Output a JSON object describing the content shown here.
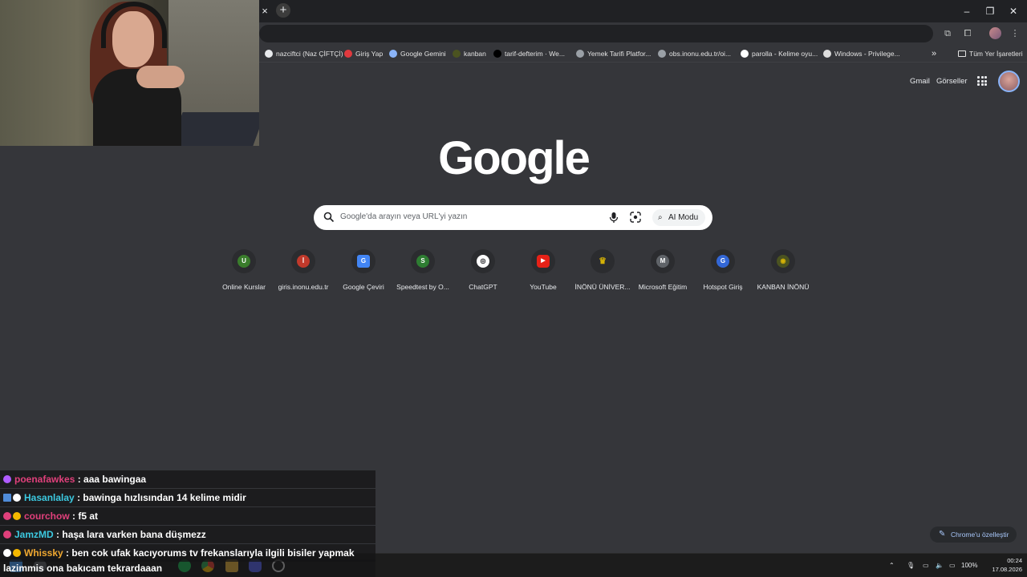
{
  "browser": {
    "tab_close_glyph": "×",
    "new_tab_glyph": "+",
    "window_controls": {
      "minimize": "–",
      "maximize": "❐",
      "close": "✕"
    },
    "toolbar_icons": [
      "cast-icon",
      "extensions-icon",
      "profile-icon",
      "menu-icon"
    ]
  },
  "bookmarks": [
    {
      "label": "nazciftci (Naz ÇİFTÇİ)",
      "icon": "github-icon",
      "color": "#e8eaed"
    },
    {
      "label": "Giriş Yap",
      "icon": "login-icon",
      "color": "#e0393e"
    },
    {
      "label": "Google Gemini",
      "icon": "gemini-icon",
      "color": "#8ab4f8"
    },
    {
      "label": "kanban",
      "icon": "kanban-icon",
      "color": "#4b5320"
    },
    {
      "label": "tarif-defterim · We...",
      "icon": "vercel-icon",
      "color": "#000000"
    },
    {
      "label": "Yemek Tarifi Platfor...",
      "icon": "globe-icon",
      "color": "#9aa0a6"
    },
    {
      "label": "obs.inonu.edu.tr/oi...",
      "icon": "globe-icon",
      "color": "#9aa0a6"
    },
    {
      "label": "parolla - Kelime oyu...",
      "icon": "parolla-icon",
      "color": "#ffffff"
    },
    {
      "label": "Windows - Privilege...",
      "icon": "windows-icon",
      "color": "#dddddd"
    }
  ],
  "bookmarks_more": "»",
  "all_bookmarks": "Tüm Yer İşaretleri",
  "header_links": {
    "gmail": "Gmail",
    "images": "Görseller"
  },
  "logo": "Google",
  "search": {
    "placeholder": "Google'da arayın veya URL'yi yazın",
    "ai_mode_label": "AI Modu"
  },
  "shortcuts": [
    {
      "label": "Online Kurslar",
      "glyph": "U",
      "color": "#3a7d2c"
    },
    {
      "label": "giris.inonu.edu.tr",
      "glyph": "İ",
      "color": "#c0392b"
    },
    {
      "label": "Google Çeviri",
      "glyph": "G",
      "color": "#4285f4"
    },
    {
      "label": "Speedtest by O...",
      "glyph": "S",
      "color": "#2e7d32"
    },
    {
      "label": "ChatGPT",
      "glyph": "◎",
      "color": "#ffffff"
    },
    {
      "label": "YouTube",
      "glyph": "▶",
      "color": "#e62117"
    },
    {
      "label": "İNÖNÜ ÜNİVER...",
      "glyph": "♛",
      "color": "#d4b106"
    },
    {
      "label": "Microsoft Eğitim",
      "glyph": "M",
      "color": "#5f6368"
    },
    {
      "label": "Hotspot Giriş",
      "glyph": "G",
      "color": "#3367d6"
    },
    {
      "label": "KANBAN İNÖNÜ",
      "glyph": "◉",
      "color": "#4b5320"
    }
  ],
  "customize_label": "Chrome'u özelleştir",
  "chat": [
    {
      "user": "poenafawkes",
      "msg": ": aaa bawingaa",
      "color": "#e0407b",
      "badges": [
        "#b05cff"
      ]
    },
    {
      "user": "Hasanlalay",
      "msg": ": bawinga hızlısından 14 kelime midir",
      "color": "#3cc9e0",
      "badges": [
        "#4f8bd8",
        "#ffffff"
      ]
    },
    {
      "user": "courchow",
      "msg": ": f5 at",
      "color": "#e0407b",
      "badges": [
        "#e0407b",
        "#f5b800"
      ]
    },
    {
      "user": "JamzMD",
      "msg": ": haşa lara varken bana düşmezz",
      "color": "#3cc9e0",
      "badges": [
        "#e0407b"
      ]
    },
    {
      "user": "Whissky",
      "msg": ": ben cok ufak kacıyorums tv frekanslarıyla ilgili bisiler yapmak",
      "color": "#f0a830",
      "badges": [
        "#ffffff",
        "#f5b800"
      ]
    },
    {
      "user": "",
      "msg": "lazimmis ona bakıcam tekrardaaan",
      "color": "#ffffff",
      "badges": []
    }
  ],
  "taskbar": {
    "apps": [
      {
        "name": "windows-start-icon",
        "color": "#4aa3ff"
      },
      {
        "name": "search-icon",
        "color": "#9aa0a6"
      },
      {
        "name": "spotify-icon",
        "color": "#1db954"
      },
      {
        "name": "chrome-icon",
        "color": "#4285f4"
      },
      {
        "name": "file-explorer-icon",
        "color": "#e8b33d"
      },
      {
        "name": "discord-icon",
        "color": "#5865f2"
      },
      {
        "name": "obs-icon",
        "color": "#cccccc"
      }
    ],
    "battery": "100%",
    "time": "00:24",
    "date": "17.08.2026"
  }
}
